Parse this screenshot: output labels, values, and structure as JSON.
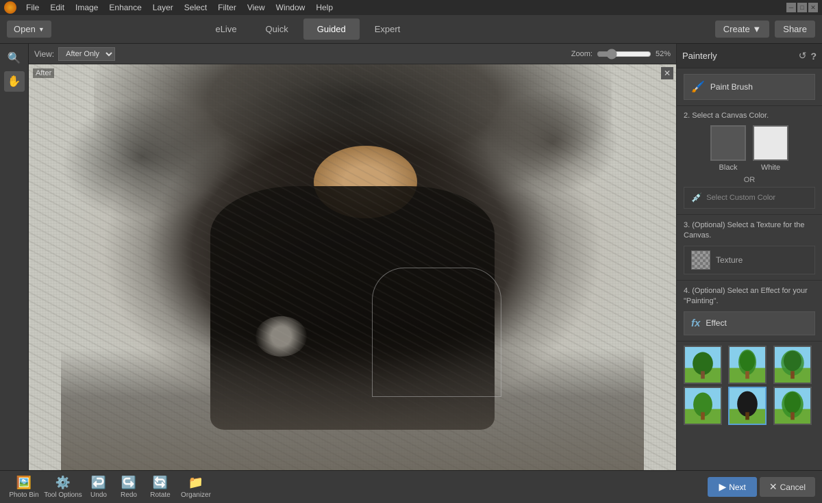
{
  "app": {
    "menu_items": [
      "File",
      "Edit",
      "Image",
      "Enhance",
      "Layer",
      "Select",
      "Filter",
      "View",
      "Window",
      "Help"
    ],
    "tabs": [
      {
        "id": "elive",
        "label": "eLive"
      },
      {
        "id": "quick",
        "label": "Quick"
      },
      {
        "id": "guided",
        "label": "Guided",
        "active": true
      },
      {
        "id": "expert",
        "label": "Expert"
      }
    ],
    "open_label": "Open",
    "create_label": "Create",
    "share_label": "Share"
  },
  "toolbar": {
    "view_label": "View:",
    "view_option": "After Only",
    "zoom_label": "Zoom:",
    "zoom_percent": "52%"
  },
  "canvas": {
    "label": "After"
  },
  "panel": {
    "title": "Painterly",
    "step1_label": "Paint Brush",
    "step2_label": "2. Select a Canvas Color.",
    "step2_or": "OR",
    "color_black_label": "Black",
    "color_white_label": "White",
    "custom_color_label": "Select Custom Color",
    "step3_label": "3. (Optional) Select a Texture for the Canvas.",
    "texture_label": "Texture",
    "step4_label": "4. (Optional) Select an Effect for your \"Painting\".",
    "effect_label": "Effect"
  },
  "bottom": {
    "photo_bin": "Photo Bin",
    "tool_options": "Tool Options",
    "undo": "Undo",
    "redo": "Redo",
    "rotate": "Rotate",
    "organizer": "Organizer",
    "next": "Next",
    "cancel": "Cancel"
  }
}
